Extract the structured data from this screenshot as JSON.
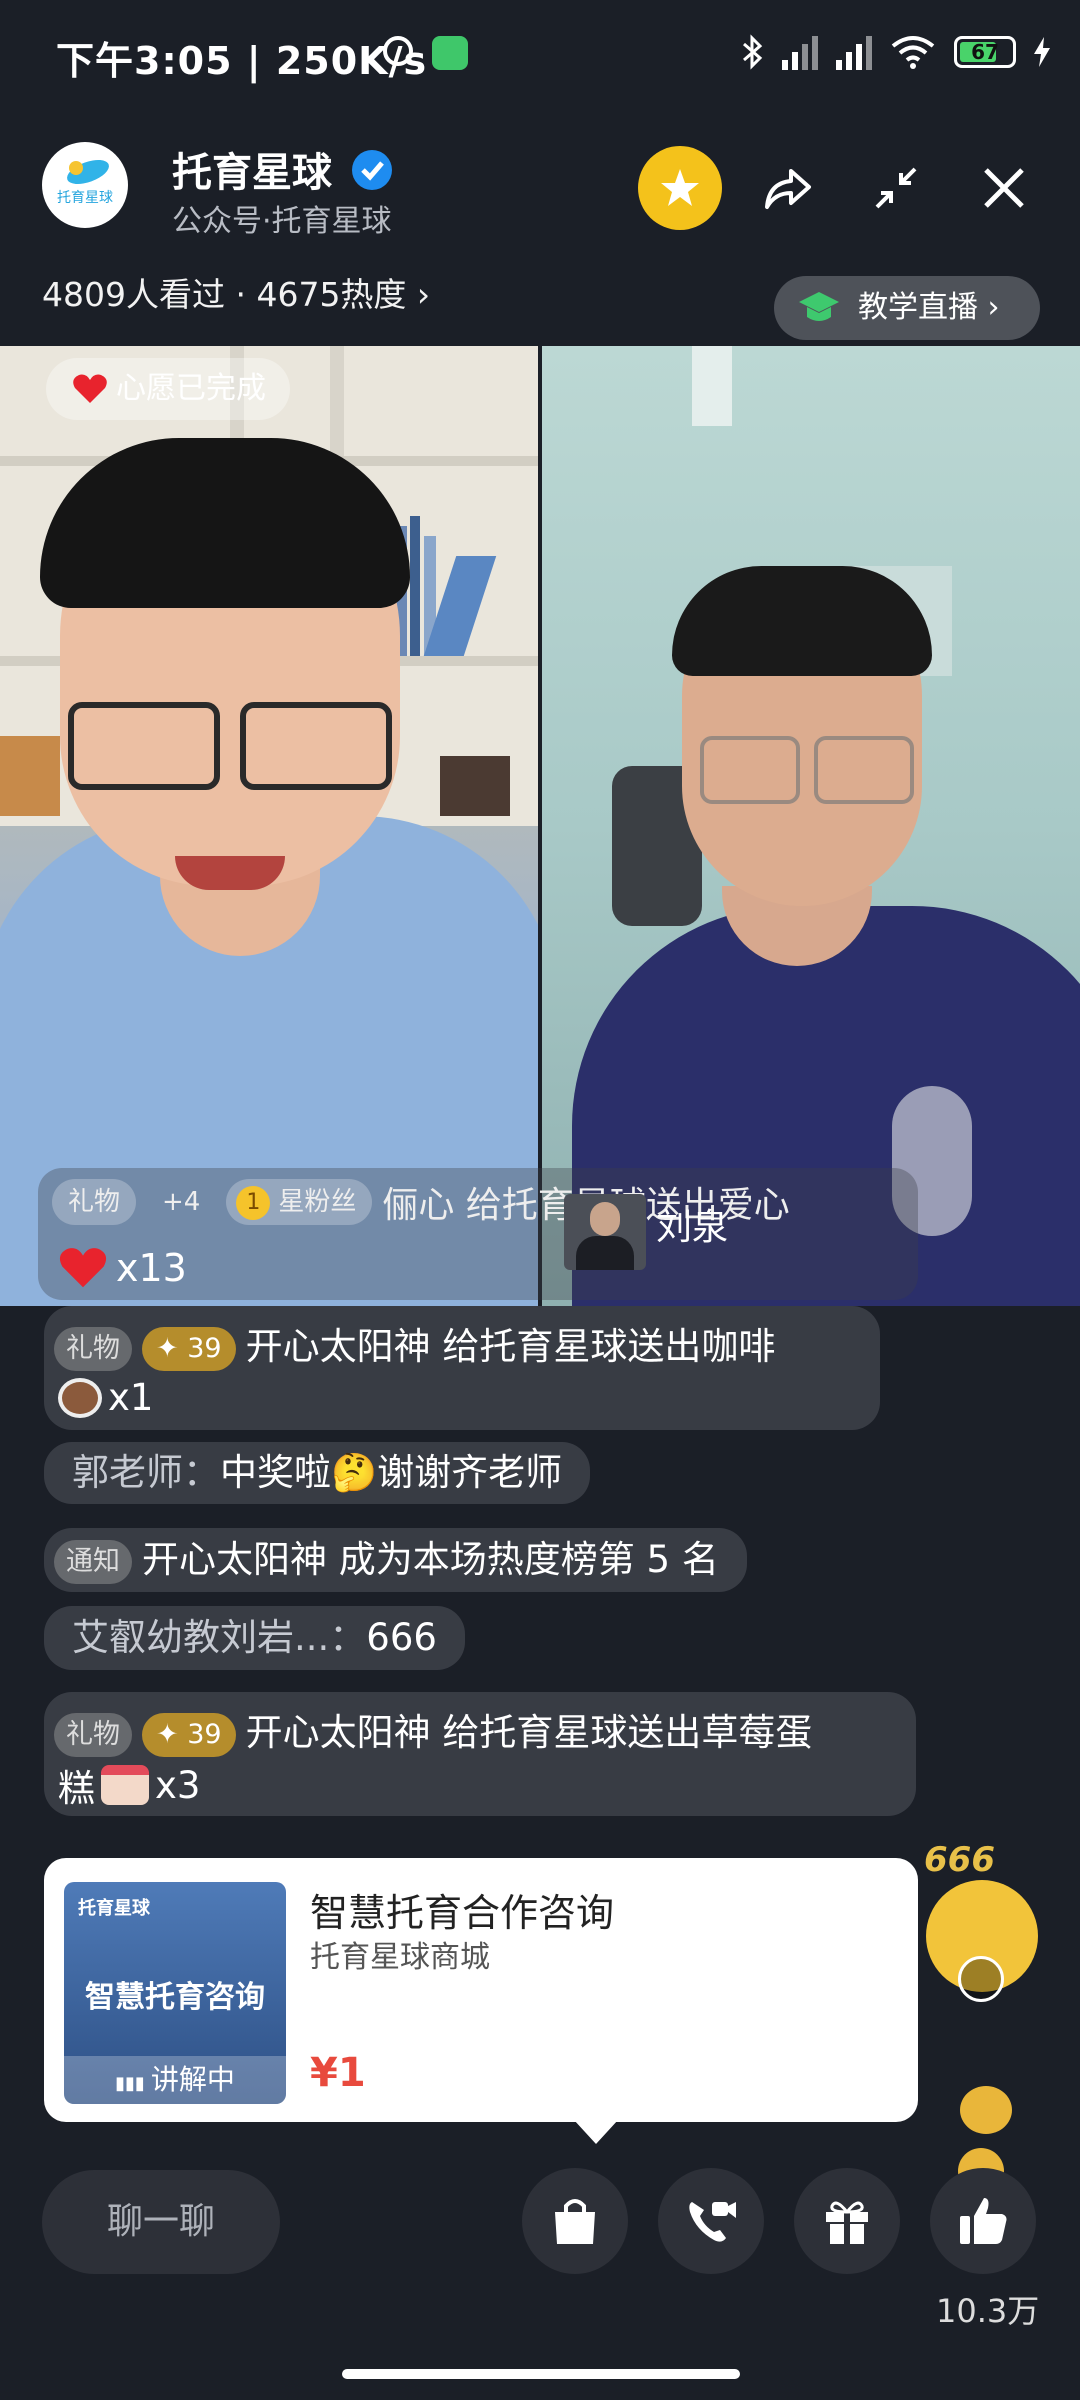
{
  "status_bar": {
    "time": "下午3:05 | 250K/s",
    "battery": "67"
  },
  "header": {
    "channel_name": "托育星球",
    "channel_sub": "公众号·托育星球",
    "avatar_text": "托育星球",
    "viewer_stats": "4809人看过 · 4675热度 ›",
    "category": "教学直播 ›"
  },
  "video": {
    "wish": "心愿已完成",
    "gift_tag": "礼物",
    "gift_plus": "+4",
    "fan_level": "1",
    "fan_label": "星粉丝",
    "gift_text": "俪心  给托育星球送出爱心",
    "gift_count": "x13",
    "guest_name": "刘泉"
  },
  "chat": [
    {
      "tag": "礼物",
      "level": "39",
      "text": "开心太阳神  给托育星球送出咖啡",
      "count": "x1"
    },
    {
      "user": "郭老师：",
      "text": "中奖啦🤔谢谢齐老师"
    },
    {
      "tag": "通知",
      "text": "开心太阳神  成为本场热度榜第 5 名"
    },
    {
      "user": "艾叡幼教刘岩...：",
      "text": "666"
    },
    {
      "tag": "礼物",
      "level": "39",
      "text": "开心太阳神  给托育星球送出草莓蛋",
      "text2": "糕",
      "count": "x3"
    }
  ],
  "product": {
    "thumb_brand": "托育星球",
    "thumb_title": "智慧托育咨询",
    "thumb_status": "讲解中",
    "title": "智慧托育合作咨询",
    "shop": "托育星球商城",
    "price": "¥1"
  },
  "bottom": {
    "chat_placeholder": "聊一聊",
    "like_count": "10.3万"
  },
  "floating": {
    "emoji_text": "666"
  },
  "colors": {
    "accent_gold": "#f4c21b",
    "price_red": "#e84a3d",
    "verified_blue": "#1e8cf0"
  }
}
